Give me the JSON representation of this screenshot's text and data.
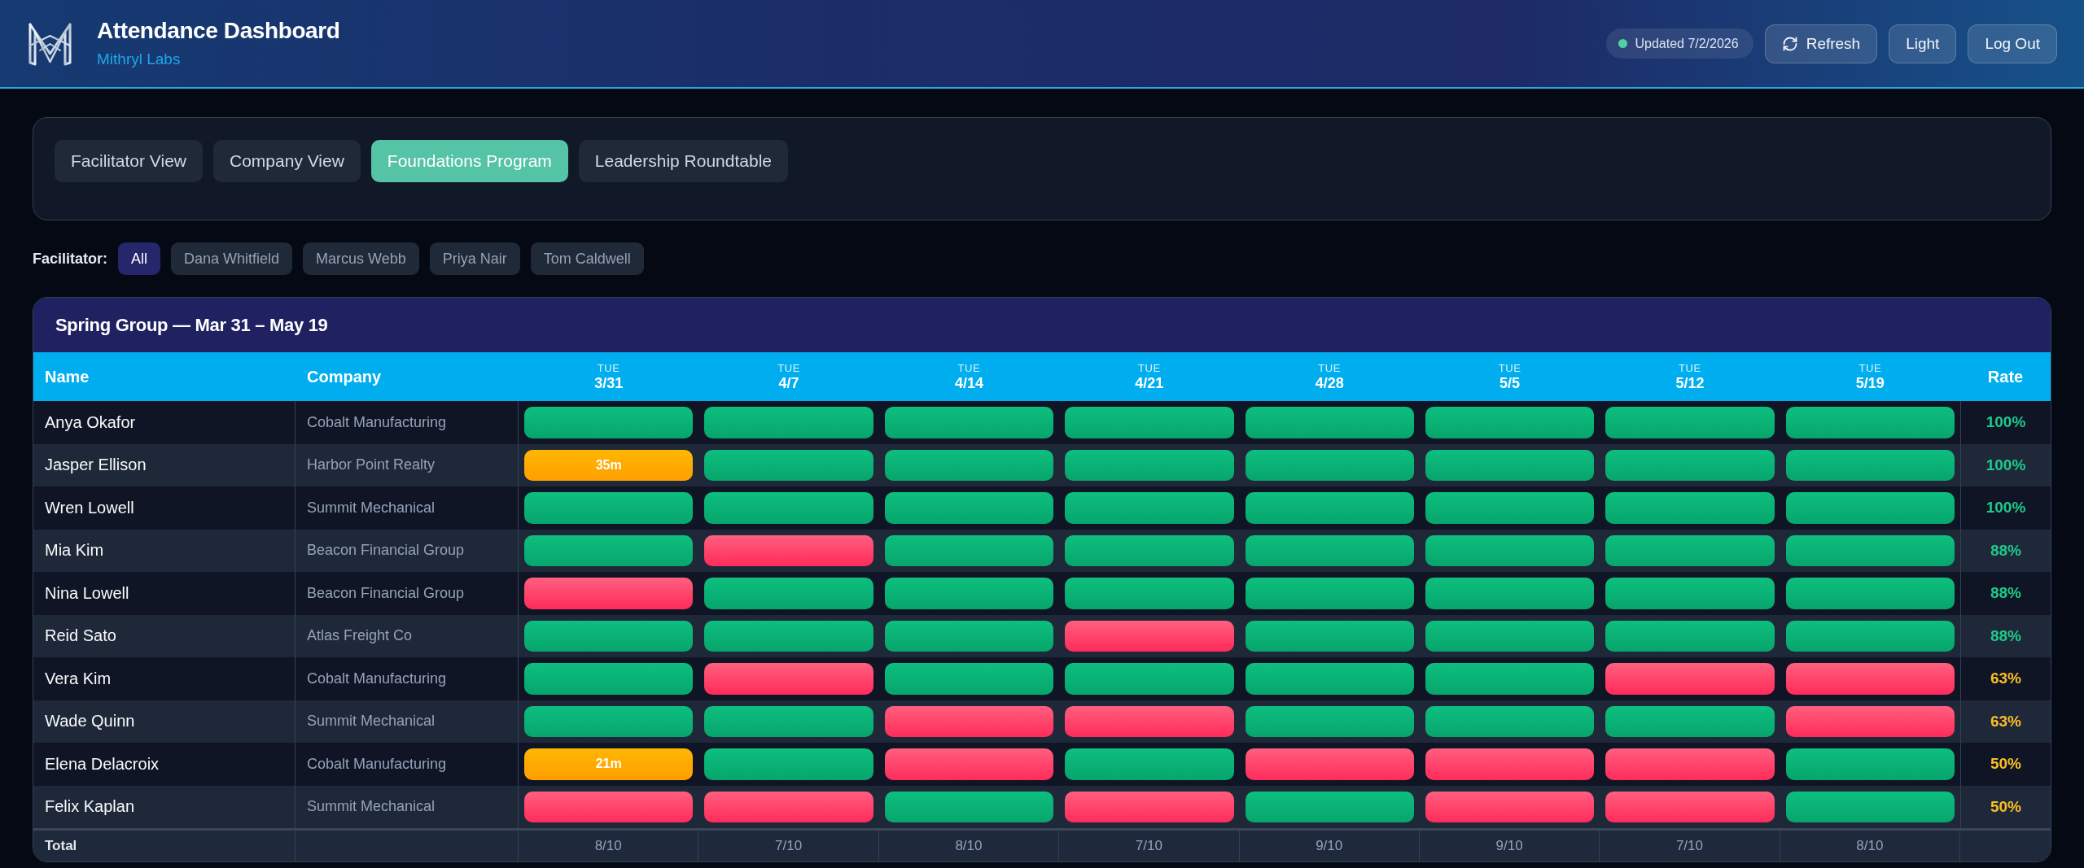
{
  "header": {
    "title": "Attendance Dashboard",
    "subtitle": "Mithryl Labs",
    "updated": "Updated 7/2/2026",
    "buttons": [
      {
        "label": "Refresh",
        "kind": "refresh"
      },
      {
        "label": "Light",
        "kind": "plain"
      },
      {
        "label": "Log Out",
        "kind": "plain"
      }
    ]
  },
  "tabs": [
    {
      "label": "Facilitator View",
      "selected": false
    },
    {
      "label": "Company View",
      "selected": false
    },
    {
      "label": "Foundations Program",
      "selected": true
    },
    {
      "label": "Leadership Roundtable",
      "selected": false
    }
  ],
  "facilitator_filter": {
    "label": "Facilitator:",
    "options": [
      {
        "label": "All",
        "selected": true
      },
      {
        "label": "Dana Whitfield",
        "selected": false
      },
      {
        "label": "Marcus Webb",
        "selected": false
      },
      {
        "label": "Priya Nair",
        "selected": false
      },
      {
        "label": "Tom Caldwell",
        "selected": false
      }
    ]
  },
  "attendance_table": {
    "title": "Spring Group — Mar 31 – May 19",
    "columns": {
      "name": "Name",
      "company": "Company",
      "sessions": [
        {
          "day": "TUE",
          "date": "3/31"
        },
        {
          "day": "TUE",
          "date": "4/7"
        },
        {
          "day": "TUE",
          "date": "4/14"
        },
        {
          "day": "TUE",
          "date": "4/21"
        },
        {
          "day": "TUE",
          "date": "4/28"
        },
        {
          "day": "TUE",
          "date": "5/5"
        },
        {
          "day": "TUE",
          "date": "5/12"
        },
        {
          "day": "TUE",
          "date": "5/19"
        }
      ],
      "rate": "Rate"
    },
    "rows": [
      {
        "name": "Anya Okafor",
        "company": "Cobalt Manufacturing",
        "attendance": [
          {
            "kind": "present"
          },
          {
            "kind": "present"
          },
          {
            "kind": "present"
          },
          {
            "kind": "present"
          },
          {
            "kind": "present"
          },
          {
            "kind": "present"
          },
          {
            "kind": "present"
          },
          {
            "kind": "present"
          }
        ],
        "rate": {
          "text": "100%",
          "color": "#1fc98a"
        }
      },
      {
        "name": "Jasper Ellison",
        "company": "Harbor Point Realty",
        "attendance": [
          {
            "kind": "late",
            "label": "35m"
          },
          {
            "kind": "present"
          },
          {
            "kind": "present"
          },
          {
            "kind": "present"
          },
          {
            "kind": "present"
          },
          {
            "kind": "present"
          },
          {
            "kind": "present"
          },
          {
            "kind": "present"
          }
        ],
        "rate": {
          "text": "100%",
          "color": "#1fc98a"
        }
      },
      {
        "name": "Wren Lowell",
        "company": "Summit Mechanical",
        "attendance": [
          {
            "kind": "present"
          },
          {
            "kind": "present"
          },
          {
            "kind": "present"
          },
          {
            "kind": "present"
          },
          {
            "kind": "present"
          },
          {
            "kind": "present"
          },
          {
            "kind": "present"
          },
          {
            "kind": "present"
          }
        ],
        "rate": {
          "text": "100%",
          "color": "#1fc98a"
        }
      },
      {
        "name": "Mia Kim",
        "company": "Beacon Financial Group",
        "attendance": [
          {
            "kind": "present"
          },
          {
            "kind": "absent"
          },
          {
            "kind": "present"
          },
          {
            "kind": "present"
          },
          {
            "kind": "present"
          },
          {
            "kind": "present"
          },
          {
            "kind": "present"
          },
          {
            "kind": "present"
          }
        ],
        "rate": {
          "text": "88%",
          "color": "#1fc98a"
        }
      },
      {
        "name": "Nina Lowell",
        "company": "Beacon Financial Group",
        "attendance": [
          {
            "kind": "absent"
          },
          {
            "kind": "present"
          },
          {
            "kind": "present"
          },
          {
            "kind": "present"
          },
          {
            "kind": "present"
          },
          {
            "kind": "present"
          },
          {
            "kind": "present"
          },
          {
            "kind": "present"
          }
        ],
        "rate": {
          "text": "88%",
          "color": "#1fc98a"
        }
      },
      {
        "name": "Reid Sato",
        "company": "Atlas Freight Co",
        "attendance": [
          {
            "kind": "present"
          },
          {
            "kind": "present"
          },
          {
            "kind": "present"
          },
          {
            "kind": "absent"
          },
          {
            "kind": "present"
          },
          {
            "kind": "present"
          },
          {
            "kind": "present"
          },
          {
            "kind": "present"
          }
        ],
        "rate": {
          "text": "88%",
          "color": "#1fc98a"
        }
      },
      {
        "name": "Vera Kim",
        "company": "Cobalt Manufacturing",
        "attendance": [
          {
            "kind": "present"
          },
          {
            "kind": "absent"
          },
          {
            "kind": "present"
          },
          {
            "kind": "present"
          },
          {
            "kind": "present"
          },
          {
            "kind": "present"
          },
          {
            "kind": "absent"
          },
          {
            "kind": "absent"
          }
        ],
        "rate": {
          "text": "63%",
          "color": "#fbbf24"
        }
      },
      {
        "name": "Wade Quinn",
        "company": "Summit Mechanical",
        "attendance": [
          {
            "kind": "present"
          },
          {
            "kind": "present"
          },
          {
            "kind": "absent"
          },
          {
            "kind": "absent"
          },
          {
            "kind": "present"
          },
          {
            "kind": "present"
          },
          {
            "kind": "present"
          },
          {
            "kind": "absent"
          }
        ],
        "rate": {
          "text": "63%",
          "color": "#fbbf24"
        }
      },
      {
        "name": "Elena Delacroix",
        "company": "Cobalt Manufacturing",
        "attendance": [
          {
            "kind": "late",
            "label": "21m"
          },
          {
            "kind": "present"
          },
          {
            "kind": "absent"
          },
          {
            "kind": "present"
          },
          {
            "kind": "absent"
          },
          {
            "kind": "absent"
          },
          {
            "kind": "absent"
          },
          {
            "kind": "present"
          }
        ],
        "rate": {
          "text": "50%",
          "color": "#fbbf24"
        }
      },
      {
        "name": "Felix Kaplan",
        "company": "Summit Mechanical",
        "attendance": [
          {
            "kind": "absent"
          },
          {
            "kind": "absent"
          },
          {
            "kind": "present"
          },
          {
            "kind": "absent"
          },
          {
            "kind": "present"
          },
          {
            "kind": "absent"
          },
          {
            "kind": "absent"
          },
          {
            "kind": "present"
          }
        ],
        "rate": {
          "text": "50%",
          "color": "#fbbf24"
        }
      }
    ],
    "total": {
      "label": "Total",
      "values": [
        "8/10",
        "7/10",
        "8/10",
        "7/10",
        "9/10",
        "9/10",
        "7/10",
        "8/10"
      ]
    }
  }
}
